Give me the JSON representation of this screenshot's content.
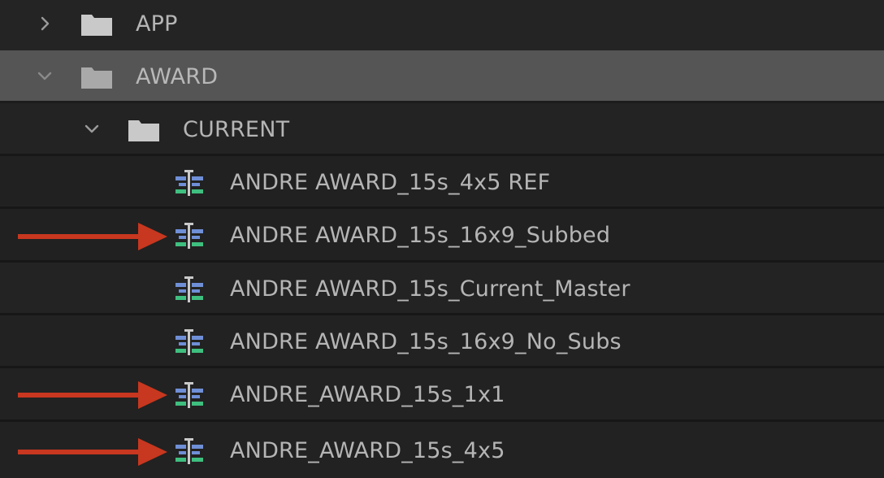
{
  "project_panel": {
    "items": [
      {
        "label": "APP",
        "type": "folder",
        "expanded": false,
        "level": 0
      },
      {
        "label": "AWARD",
        "type": "folder",
        "expanded": true,
        "selected": true,
        "level": 0
      },
      {
        "label": "CURRENT",
        "type": "folder",
        "expanded": true,
        "level": 1
      },
      {
        "label": "ANDRE AWARD_15s_4x5 REF",
        "type": "sequence",
        "level": 2,
        "marked": false
      },
      {
        "label": "ANDRE AWARD_15s_16x9_Subbed",
        "type": "sequence",
        "level": 2,
        "marked": true
      },
      {
        "label": "ANDRE AWARD_15s_Current_Master",
        "type": "sequence",
        "level": 2,
        "marked": false
      },
      {
        "label": "ANDRE AWARD_15s_16x9_No_Subs",
        "type": "sequence",
        "level": 2,
        "marked": false
      },
      {
        "label": "ANDRE_AWARD_15s_1x1",
        "type": "sequence",
        "level": 2,
        "marked": true
      },
      {
        "label": "ANDRE_AWARD_15s_4x5",
        "type": "sequence",
        "level": 2,
        "marked": true
      }
    ]
  },
  "colors": {
    "background": "#202020",
    "selected_row": "#555555",
    "text": "#b5b5b5",
    "folder": "#c8c8c8",
    "annotation_arrow": "#c8371f",
    "sequence_icon_blue": "#6f8fd6",
    "sequence_icon_green": "#3fbf7f"
  },
  "icons": {
    "chevron_collapsed": "chevron-right-icon",
    "chevron_expanded": "chevron-down-icon",
    "folder": "folder-icon",
    "sequence": "sequence-icon",
    "annotation": "red-arrow-annotation"
  }
}
